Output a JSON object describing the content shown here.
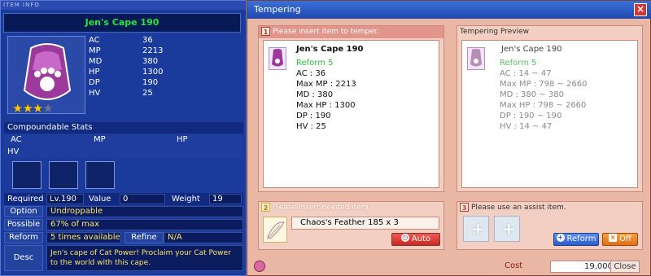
{
  "item_info": {
    "title": "ITEM INFO",
    "name": "Jen's Cape 190",
    "stats": [
      {
        "k": "AC",
        "v": "36"
      },
      {
        "k": "MP",
        "v": "2213"
      },
      {
        "k": "MD",
        "v": "380"
      },
      {
        "k": "HP",
        "v": "1300"
      },
      {
        "k": "DP",
        "v": "190"
      },
      {
        "k": "HV",
        "v": "25"
      }
    ],
    "stars_on": 3,
    "stars_total": 4,
    "compoundable": {
      "title": "Compoundable Stats",
      "cols": [
        "AC",
        "MP",
        "HP"
      ],
      "extra": "HV"
    },
    "required": {
      "label": "Required",
      "level": "Lv.190",
      "value_label": "Value",
      "value": "0",
      "weight_label": "Weight",
      "weight": "19"
    },
    "option": {
      "label": "Option",
      "value": "Undroppable"
    },
    "possible": {
      "label": "Possible",
      "value": "67% of max"
    },
    "reform": {
      "label": "Reform",
      "value": "5 times available",
      "refine_label": "Refine",
      "refine_value": "N/A"
    },
    "desc": {
      "label": "Desc",
      "value": "Jen's cape of Cat Power! Proclaim your Cat Power to the world with this cape."
    }
  },
  "tempering": {
    "title": "Tempering",
    "close_icon": "×",
    "panel1": {
      "num": "1",
      "header": "Please insert item to temper.",
      "item_name": "Jen's Cape 190",
      "reform": "Reform 5",
      "lines": [
        "AC : 36",
        "Max MP : 2213",
        "MD : 380",
        "Max HP : 1300",
        "DP : 190",
        "HV : 25"
      ]
    },
    "preview": {
      "header": "Tempering Preview",
      "item_name": "Jen's Cape 190",
      "reform": "Reform 5",
      "lines": [
        "AC : 14 ~ 47",
        "Max MP : 798 ~ 2660",
        "MD : 380 ~ 380",
        "Max HP : 798 ~ 2660",
        "DP : 190 ~ 190",
        "HV : 14 ~ 47"
      ]
    },
    "panel2": {
      "num": "2",
      "header": "Please insert needed item.",
      "item": "Chaos's Feather 185 x 3",
      "auto_btn": "Auto"
    },
    "panel3": {
      "num": "3",
      "header": "Please use an assist item.",
      "reform_btn": "Reform",
      "off_btn": "Off"
    },
    "cost_label": "Cost",
    "cost_value": "19,000",
    "close_btn": "Close"
  }
}
